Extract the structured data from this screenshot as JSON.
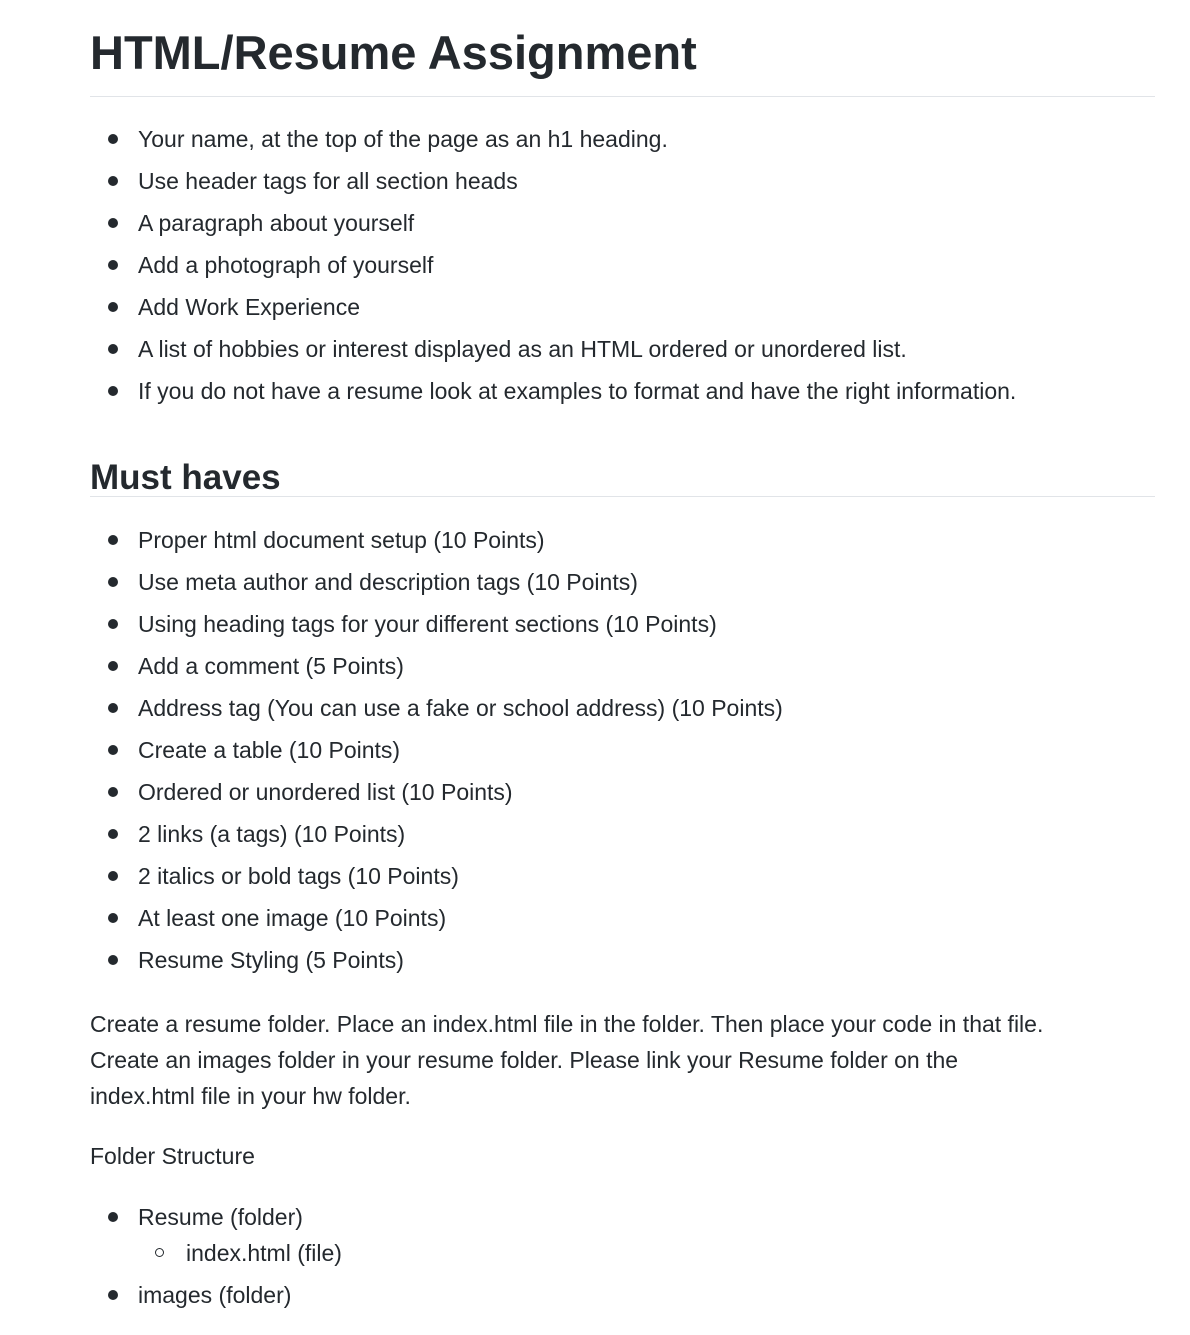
{
  "title": "HTML/Resume Assignment",
  "requirements": [
    "Your name, at the top of the page as an h1 heading.",
    "Use header tags for all section heads",
    "A paragraph about yourself",
    "Add a photograph of yourself",
    "Add Work Experience",
    "A list of hobbies or interest displayed as an HTML ordered or unordered list.",
    "If you do not have a resume look at examples to format and have the right information."
  ],
  "must_haves": {
    "heading": "Must haves",
    "items": [
      "Proper html document setup (10 Points)",
      "Use meta author and description tags (10 Points)",
      "Using heading tags for your different sections (10 Points)",
      "Add a comment (5 Points)",
      "Address tag (You can use a fake or school address) (10 Points)",
      "Create a table (10 Points)",
      "Ordered or unordered list (10 Points)",
      "2 links (a tags) (10 Points)",
      "2 italics or bold tags (10 Points)",
      "At least one image (10 Points)",
      "Resume Styling (5 Points)"
    ]
  },
  "instructions": {
    "lines": [
      "Create a resume folder. Place an index.html file in the folder. Then place your code in that file.",
      "Create an images folder in your resume folder. Please link your Resume folder on the",
      "index.html file in your hw folder."
    ]
  },
  "folder_structure": {
    "label": "Folder Structure",
    "items": [
      {
        "name": "Resume (folder)",
        "children": [
          "index.html (file)"
        ]
      },
      {
        "name": "images (folder)",
        "children": []
      }
    ]
  }
}
